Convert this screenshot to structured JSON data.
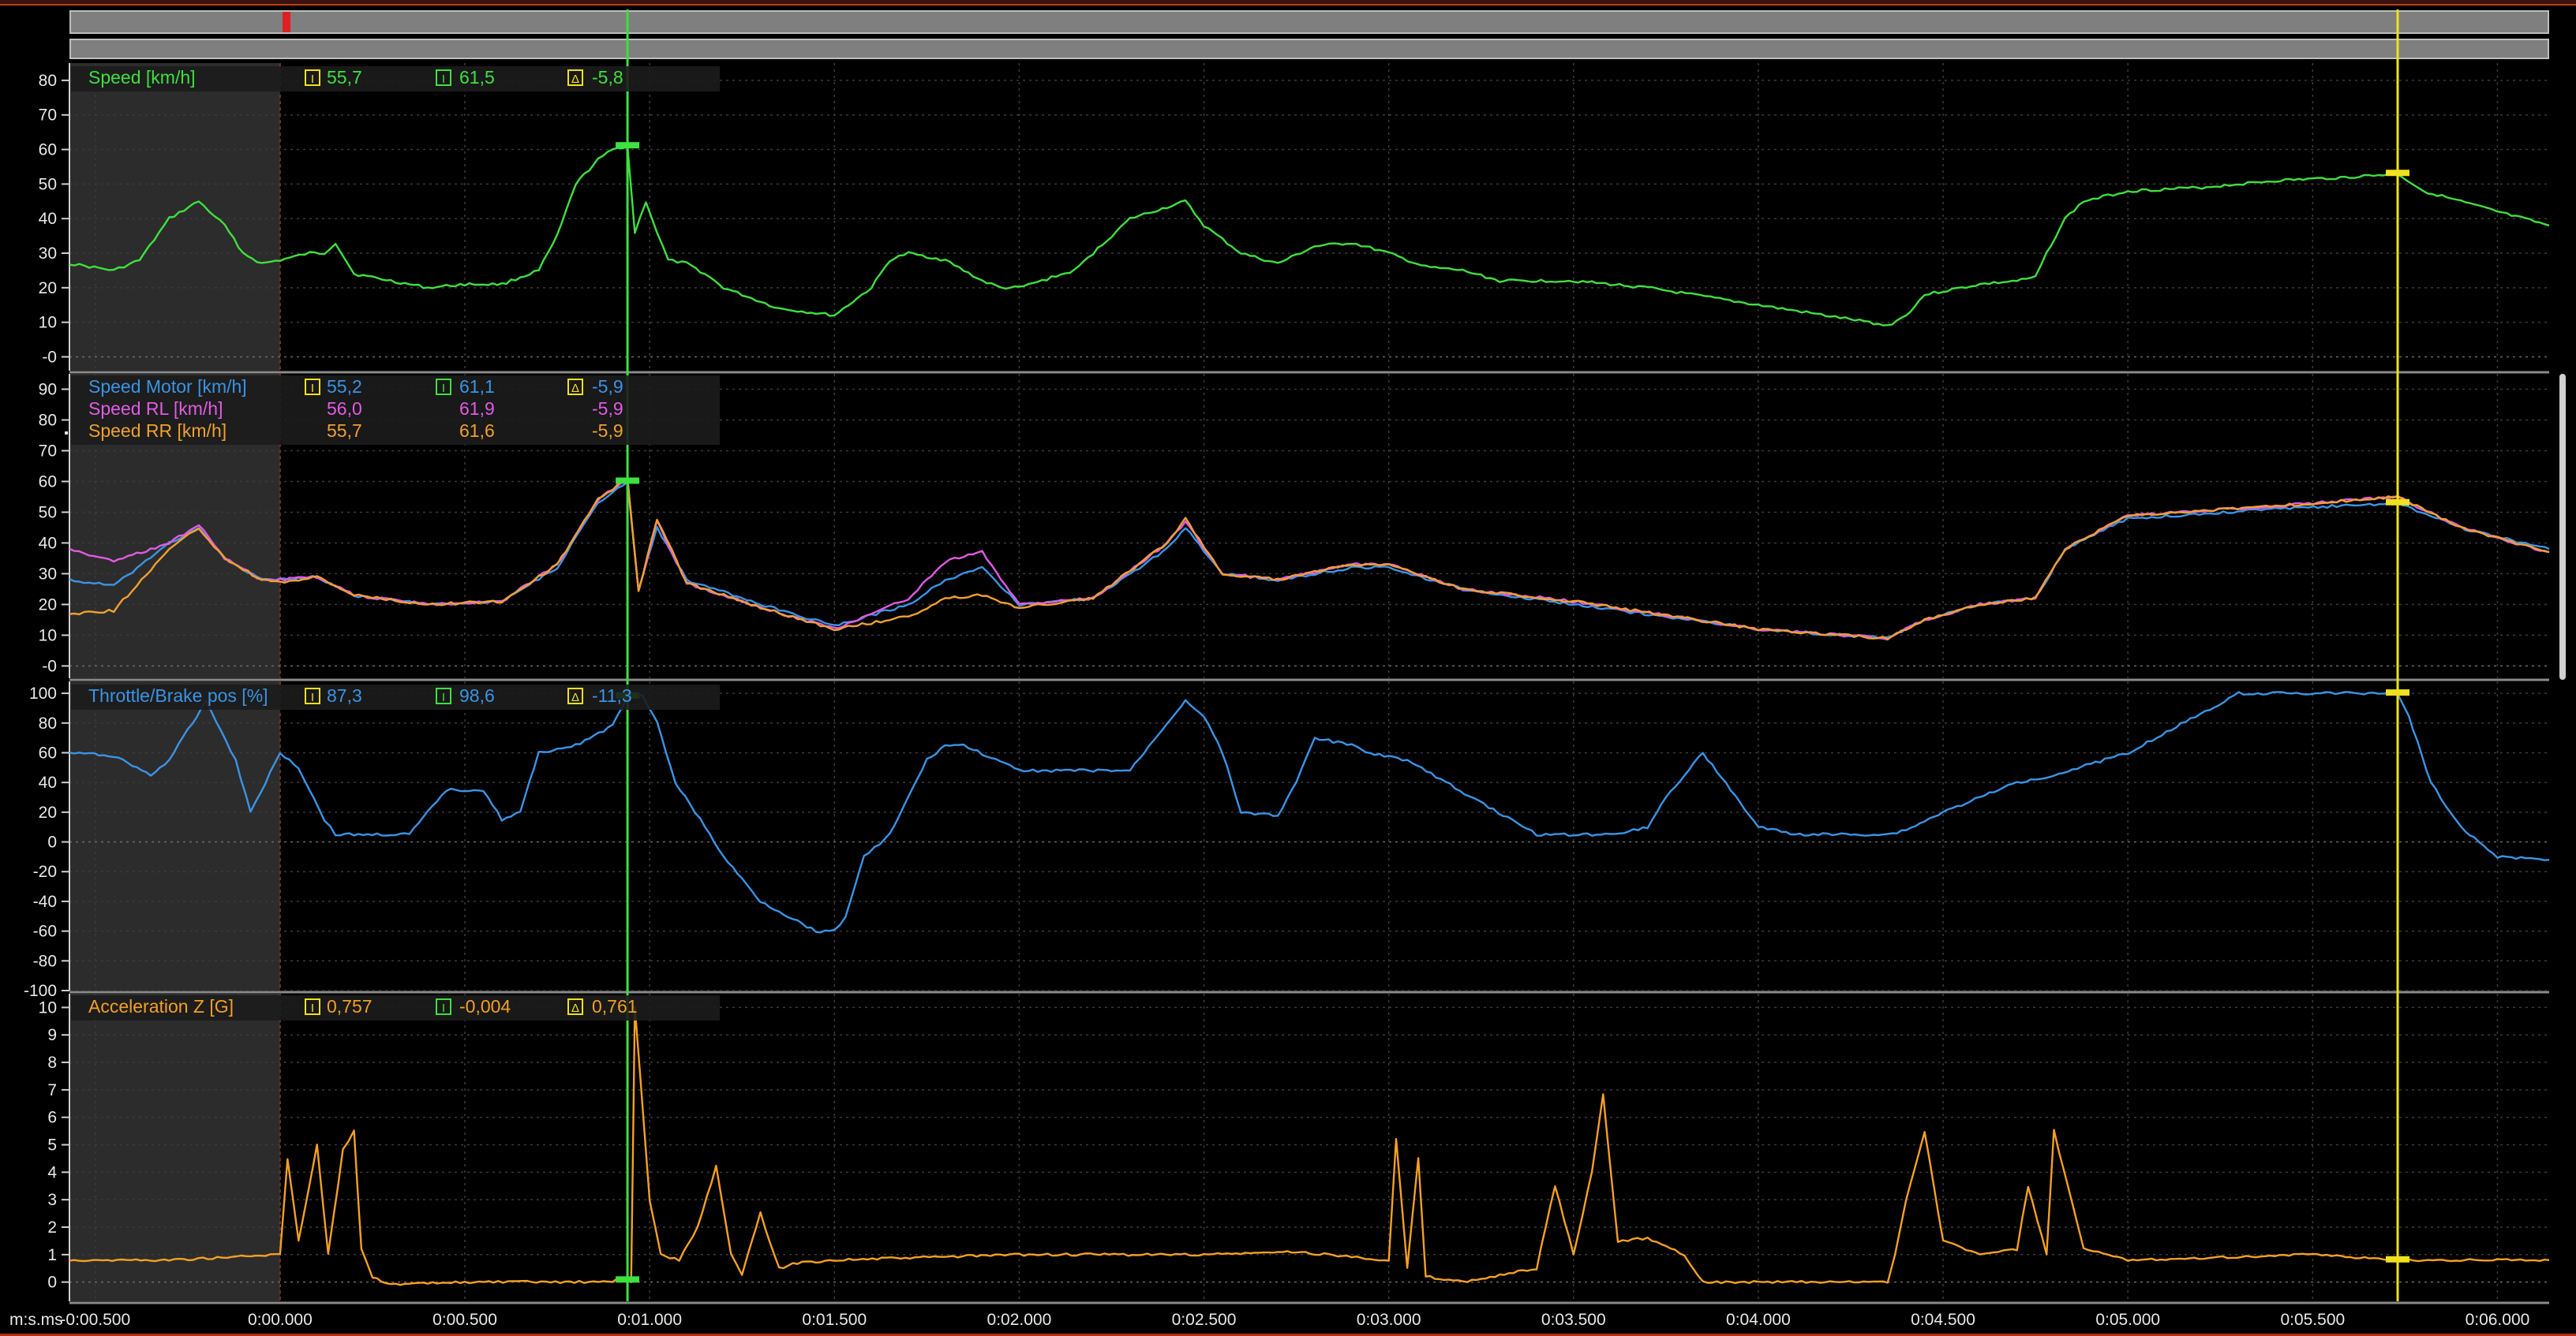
{
  "colors": {
    "speed": "#3fe03f",
    "motor": "#3a94e6",
    "rl": "#e15be3",
    "rr": "#f0a030",
    "throttle": "#3a94e6",
    "accel": "#f4a024",
    "cursor_a": "#3fe03f",
    "cursor_b": "#f0e020",
    "delta": "#f0e020",
    "grid": "#3a3a3a",
    "shade": "#2c2c2c"
  },
  "x_axis": {
    "unit_label": "m:s.ms",
    "ticks": [
      "-0:00.500",
      "0:00.000",
      "0:00.500",
      "0:01.000",
      "0:01.500",
      "0:02.000",
      "0:02.500",
      "0:03.000",
      "0:03.500",
      "0:04.000",
      "0:04.500",
      "0:05.000",
      "0:05.500",
      "0:06.000"
    ],
    "tick_values": [
      -0.5,
      0,
      0.5,
      1,
      1.5,
      2,
      2.5,
      3,
      3.5,
      4,
      4.5,
      5,
      5.5,
      6
    ],
    "range": [
      -0.57,
      6.14
    ],
    "cursor_a": 0.94,
    "cursor_b": 5.73,
    "shade_until": 0
  },
  "panels": [
    {
      "id": "speed",
      "ticks": [
        "80",
        "70",
        "60",
        "50",
        "40",
        "30",
        "20",
        "10",
        "-0"
      ],
      "tick_values": [
        80,
        70,
        60,
        50,
        40,
        30,
        20,
        10,
        0
      ],
      "range": [
        -4,
        85
      ],
      "channels": [
        {
          "name": "Speed [km/h]",
          "color_key": "speed",
          "v1": "55,7",
          "v2": "61,5",
          "dv": "-5,8"
        }
      ]
    },
    {
      "id": "wheels",
      "ticks": [
        "90",
        "80",
        "70",
        "60",
        "50",
        "40",
        "30",
        "20",
        "10",
        "-0"
      ],
      "tick_values": [
        90,
        80,
        70,
        60,
        50,
        40,
        30,
        20,
        10,
        0
      ],
      "range": [
        -4,
        95
      ],
      "channels": [
        {
          "name": "Speed Motor [km/h]",
          "color_key": "motor",
          "v1": "55,2",
          "v2": "61,1",
          "dv": "-5,9"
        },
        {
          "name": "Speed RL [km/h]",
          "color_key": "rl",
          "v1": "56,0",
          "v2": "61,9",
          "dv": "-5,9"
        },
        {
          "name": "Speed RR [km/h]",
          "color_key": "rr",
          "v1": "55,7",
          "v2": "61,6",
          "dv": "-5,9"
        }
      ]
    },
    {
      "id": "throttle",
      "ticks": [
        "100",
        "80",
        "60",
        "40",
        "20",
        "0",
        "-20",
        "-40",
        "-60",
        "-80",
        "-100"
      ],
      "tick_values": [
        100,
        80,
        60,
        40,
        20,
        0,
        -20,
        -40,
        -60,
        -80,
        -100
      ],
      "range": [
        -100,
        108
      ],
      "channels": [
        {
          "name": "Throttle/Brake pos [%]",
          "color_key": "throttle",
          "v1": "87,3",
          "v2": "98,6",
          "dv": "-11,3"
        }
      ]
    },
    {
      "id": "accel",
      "ticks": [
        "10",
        "9",
        "8",
        "7",
        "6",
        "5",
        "4",
        "3",
        "2",
        "1",
        "0"
      ],
      "tick_values": [
        10,
        9,
        8,
        7,
        6,
        5,
        4,
        3,
        2,
        1,
        0
      ],
      "range": [
        -0.7,
        10.5
      ],
      "channels": [
        {
          "name": "Acceleration Z [G]",
          "color_key": "accel",
          "v1": "0,757",
          "v2": "-0,004",
          "dv": "0,761"
        }
      ]
    }
  ],
  "chart_data": [
    {
      "type": "line",
      "x_label": "m:s.ms",
      "x_range": [
        -0.57,
        6.14
      ],
      "y_range": [
        -4,
        85
      ],
      "series": [
        {
          "name": "Speed [km/h]",
          "x": [
            -0.57,
            -0.45,
            -0.38,
            -0.3,
            -0.22,
            -0.15,
            -0.1,
            -0.05,
            0.0,
            0.08,
            0.12,
            0.15,
            0.2,
            0.3,
            0.4,
            0.5,
            0.6,
            0.7,
            0.75,
            0.8,
            0.86,
            0.9,
            0.94,
            0.96,
            0.99,
            1.02,
            1.05,
            1.1,
            1.15,
            1.2,
            1.35,
            1.5,
            1.6,
            1.65,
            1.7,
            1.8,
            1.9,
            1.95,
            2.0,
            2.15,
            2.3,
            2.45,
            2.5,
            2.6,
            2.7,
            2.8,
            2.9,
            3.0,
            3.1,
            3.2,
            3.3,
            3.5,
            3.7,
            4.0,
            4.3,
            4.35,
            4.4,
            4.45,
            4.6,
            4.7,
            4.75,
            4.78,
            4.83,
            4.88,
            5.0,
            5.2,
            5.4,
            5.6,
            5.73,
            5.8,
            6.0,
            6.14
          ],
          "y": [
            27,
            25,
            28,
            40,
            45,
            38,
            30,
            27,
            28,
            30,
            30,
            33,
            24,
            22,
            20,
            21,
            21,
            25,
            35,
            50,
            57,
            60,
            61,
            36,
            45,
            36,
            28,
            27,
            24,
            20,
            14,
            12,
            20,
            28,
            30,
            28,
            22,
            20,
            20,
            25,
            40,
            45,
            38,
            30,
            27,
            32,
            33,
            30,
            26,
            25,
            22,
            22,
            20,
            15,
            10,
            9,
            12,
            18,
            21,
            22,
            23,
            30,
            40,
            45,
            48,
            49,
            51,
            52,
            53,
            48,
            42,
            38
          ]
        }
      ]
    },
    {
      "type": "line",
      "x_label": "m:s.ms",
      "x_range": [
        -0.57,
        6.14
      ],
      "y_range": [
        -4,
        95
      ],
      "series": [
        {
          "name": "Speed Motor [km/h]",
          "x": [
            -0.57,
            -0.45,
            -0.3,
            -0.22,
            -0.15,
            -0.05,
            0.0,
            0.1,
            0.2,
            0.4,
            0.6,
            0.75,
            0.86,
            0.94,
            0.97,
            1.02,
            1.1,
            1.3,
            1.5,
            1.7,
            1.8,
            1.9,
            2.0,
            2.2,
            2.4,
            2.45,
            2.55,
            2.7,
            2.9,
            3.0,
            3.2,
            3.5,
            4.0,
            4.35,
            4.45,
            4.6,
            4.75,
            4.83,
            5.0,
            5.4,
            5.73,
            5.9,
            6.14
          ],
          "y": [
            28,
            26,
            40,
            45,
            35,
            28,
            28,
            29,
            23,
            20,
            21,
            32,
            53,
            60,
            25,
            45,
            28,
            20,
            13,
            20,
            28,
            32,
            20,
            22,
            38,
            45,
            30,
            28,
            32,
            32,
            25,
            20,
            12,
            9,
            15,
            20,
            22,
            38,
            48,
            51,
            53,
            45,
            38
          ]
        },
        {
          "name": "Speed RL [km/h]",
          "x": [
            -0.57,
            -0.45,
            -0.3,
            -0.22,
            -0.15,
            -0.05,
            0.0,
            0.1,
            0.2,
            0.4,
            0.6,
            0.75,
            0.86,
            0.94,
            0.97,
            1.02,
            1.1,
            1.3,
            1.5,
            1.7,
            1.8,
            1.9,
            2.0,
            2.2,
            2.4,
            2.45,
            2.55,
            2.7,
            2.9,
            3.0,
            3.2,
            3.5,
            4.0,
            4.35,
            4.45,
            4.6,
            4.75,
            4.83,
            5.0,
            5.4,
            5.73,
            5.9,
            6.14
          ],
          "y": [
            38,
            34,
            40,
            46,
            35,
            28,
            28,
            29,
            23,
            20,
            21,
            33,
            54,
            61,
            24,
            47,
            27,
            19,
            12,
            22,
            34,
            37,
            20,
            22,
            40,
            47,
            30,
            28,
            33,
            33,
            25,
            21,
            12,
            9,
            15,
            20,
            22,
            38,
            49,
            52,
            55,
            45,
            37
          ]
        },
        {
          "name": "Speed RR [km/h]",
          "x": [
            -0.57,
            -0.45,
            -0.3,
            -0.22,
            -0.15,
            -0.05,
            0.0,
            0.1,
            0.2,
            0.4,
            0.6,
            0.75,
            0.86,
            0.94,
            0.97,
            1.02,
            1.1,
            1.3,
            1.5,
            1.7,
            1.8,
            1.9,
            2.0,
            2.2,
            2.4,
            2.45,
            2.55,
            2.7,
            2.9,
            3.0,
            3.2,
            3.5,
            4.0,
            4.35,
            4.45,
            4.6,
            4.75,
            4.83,
            5.0,
            5.4,
            5.73,
            5.9,
            6.14
          ],
          "y": [
            17,
            18,
            38,
            45,
            35,
            28,
            27,
            29,
            23,
            20,
            21,
            33,
            54,
            61,
            24,
            48,
            27,
            19,
            12,
            16,
            22,
            23,
            19,
            22,
            40,
            48,
            30,
            28,
            33,
            33,
            25,
            21,
            12,
            9,
            15,
            20,
            22,
            38,
            49,
            52,
            55,
            45,
            37
          ]
        }
      ]
    },
    {
      "type": "line",
      "x_label": "m:s.ms",
      "x_range": [
        -0.57,
        6.14
      ],
      "y_range": [
        -100,
        108
      ],
      "series": [
        {
          "name": "Throttle/Brake pos [%]",
          "x": [
            -0.57,
            -0.45,
            -0.35,
            -0.3,
            -0.2,
            -0.12,
            -0.08,
            0.0,
            0.05,
            0.12,
            0.15,
            0.35,
            0.45,
            0.55,
            0.6,
            0.65,
            0.7,
            0.8,
            0.9,
            0.94,
            0.98,
            1.02,
            1.07,
            1.15,
            1.2,
            1.3,
            1.45,
            1.5,
            1.53,
            1.58,
            1.65,
            1.75,
            1.8,
            1.85,
            2.0,
            2.15,
            2.3,
            2.4,
            2.45,
            2.5,
            2.55,
            2.6,
            2.7,
            2.75,
            2.8,
            2.9,
            2.95,
            3.05,
            3.4,
            3.5,
            3.6,
            3.7,
            3.75,
            3.85,
            4.0,
            4.1,
            4.2,
            4.35,
            4.4,
            4.5,
            4.6,
            4.7,
            4.8,
            5.0,
            5.3,
            5.6,
            5.73,
            5.76,
            5.82,
            5.9,
            6.0,
            6.14
          ],
          "y": [
            60,
            58,
            45,
            55,
            95,
            55,
            20,
            60,
            50,
            15,
            5,
            5,
            35,
            35,
            15,
            20,
            60,
            65,
            78,
            98,
            98,
            80,
            40,
            10,
            -10,
            -40,
            -60,
            -60,
            -50,
            -10,
            5,
            55,
            65,
            65,
            48,
            48,
            48,
            80,
            95,
            85,
            60,
            20,
            18,
            40,
            70,
            65,
            60,
            55,
            5,
            5,
            5,
            10,
            30,
            60,
            10,
            5,
            5,
            5,
            8,
            20,
            30,
            40,
            45,
            60,
            100,
            100,
            100,
            85,
            40,
            10,
            -10,
            -12
          ]
        }
      ]
    },
    {
      "type": "line",
      "x_label": "m:s.ms",
      "x_range": [
        -0.57,
        6.14
      ],
      "y_range": [
        -0.7,
        10.5
      ],
      "series": [
        {
          "name": "Acceleration Z [G]",
          "x": [
            -0.57,
            -0.3,
            0.0,
            0.02,
            0.05,
            0.1,
            0.13,
            0.17,
            0.2,
            0.22,
            0.25,
            0.3,
            0.5,
            0.9,
            0.92,
            0.95,
            0.96,
            1.0,
            1.03,
            1.08,
            1.13,
            1.18,
            1.22,
            1.25,
            1.3,
            1.35,
            1.4,
            1.5,
            2.0,
            2.5,
            2.75,
            3.0,
            3.02,
            3.05,
            3.08,
            3.1,
            3.2,
            3.4,
            3.45,
            3.5,
            3.55,
            3.58,
            3.62,
            3.7,
            3.8,
            3.85,
            4.0,
            4.35,
            4.37,
            4.4,
            4.45,
            4.5,
            4.6,
            4.7,
            4.73,
            4.78,
            4.8,
            4.88,
            5.0,
            5.5,
            5.73,
            5.8,
            6.0,
            6.14
          ],
          "y": [
            0.8,
            0.8,
            1.0,
            4.5,
            1.5,
            5.0,
            1.0,
            4.8,
            5.5,
            1.2,
            0.2,
            -0.1,
            0.0,
            0.0,
            0.2,
            0.0,
            10.0,
            3.0,
            1.0,
            0.8,
            2.0,
            4.2,
            1.0,
            0.3,
            2.5,
            0.5,
            0.7,
            0.8,
            1.0,
            1.0,
            1.1,
            0.8,
            5.2,
            0.5,
            4.5,
            0.2,
            0.0,
            0.5,
            3.5,
            1.0,
            4.0,
            6.8,
            1.5,
            1.6,
            1.0,
            0.0,
            0.0,
            0.0,
            1.0,
            3.0,
            5.5,
            1.5,
            1.0,
            1.2,
            3.5,
            1.0,
            5.5,
            1.2,
            0.8,
            1.0,
            0.8,
            0.8,
            0.8,
            0.8
          ]
        }
      ]
    }
  ]
}
